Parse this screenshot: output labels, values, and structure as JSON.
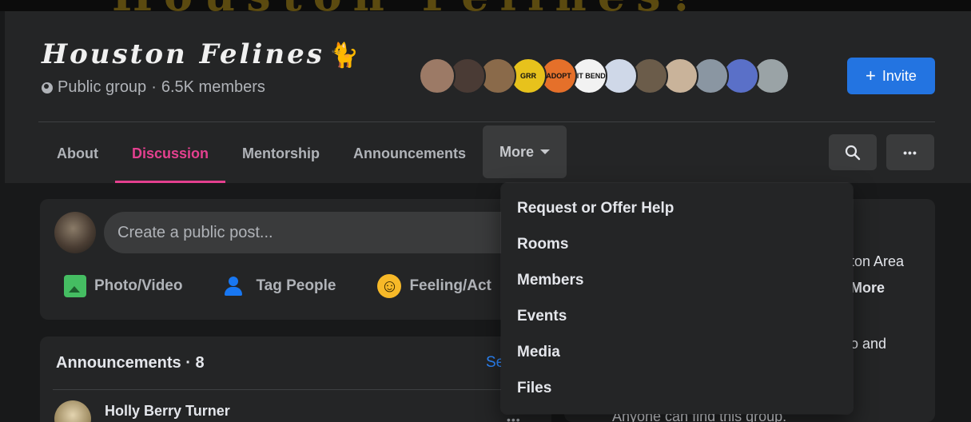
{
  "cover": {
    "text": "Houston Felines!"
  },
  "group": {
    "name": "Houston Felines",
    "emoji": "🐈",
    "privacy": "Public group",
    "separator": "·",
    "members": "6.5K members"
  },
  "members_avatars": [
    {
      "label": "",
      "color": "#9c7a66"
    },
    {
      "label": "",
      "color": "#4a3b35"
    },
    {
      "label": "",
      "color": "#8a6a4a"
    },
    {
      "label": "GRR",
      "color": "#e7c21c"
    },
    {
      "label": "ADOPT",
      "color": "#e5702a"
    },
    {
      "label": "FIT BEND",
      "color": "#f2f2f2"
    },
    {
      "label": "",
      "color": "#cfd8e8"
    },
    {
      "label": "",
      "color": "#6b5c4a"
    },
    {
      "label": "",
      "color": "#c9b39a"
    },
    {
      "label": "",
      "color": "#8a96a2"
    },
    {
      "label": "",
      "color": "#5a70c8"
    },
    {
      "label": "",
      "color": "#9aa3a6"
    }
  ],
  "invite_button": {
    "plus": "+",
    "label": "Invite"
  },
  "tabs": [
    {
      "label": "About"
    },
    {
      "label": "Discussion"
    },
    {
      "label": "Mentorship"
    },
    {
      "label": "Announcements"
    },
    {
      "label": "More"
    }
  ],
  "active_tab": "Discussion",
  "more_menu": {
    "items": [
      "Request or Offer Help",
      "Rooms",
      "Members",
      "Events",
      "Media",
      "Files"
    ]
  },
  "toolbar": {
    "more_dots": "•••"
  },
  "composer": {
    "placeholder": "Create a public post...",
    "actions": {
      "photo": "Photo/Video",
      "tag": "Tag People",
      "feeling": "Feeling/Act"
    }
  },
  "right_panel": {
    "line1": "ton Area",
    "line2": "More",
    "line3": "o and",
    "line4": "Anyone can find this group."
  },
  "announcements": {
    "header": "Announcements · 8",
    "see_all": "Se",
    "post": {
      "author": "Holly Berry Turner",
      "dots": "•••"
    }
  },
  "colors": {
    "accent": "#e4408f",
    "brand_blue": "#2374e1",
    "background": "#18191a",
    "card": "#242526"
  }
}
